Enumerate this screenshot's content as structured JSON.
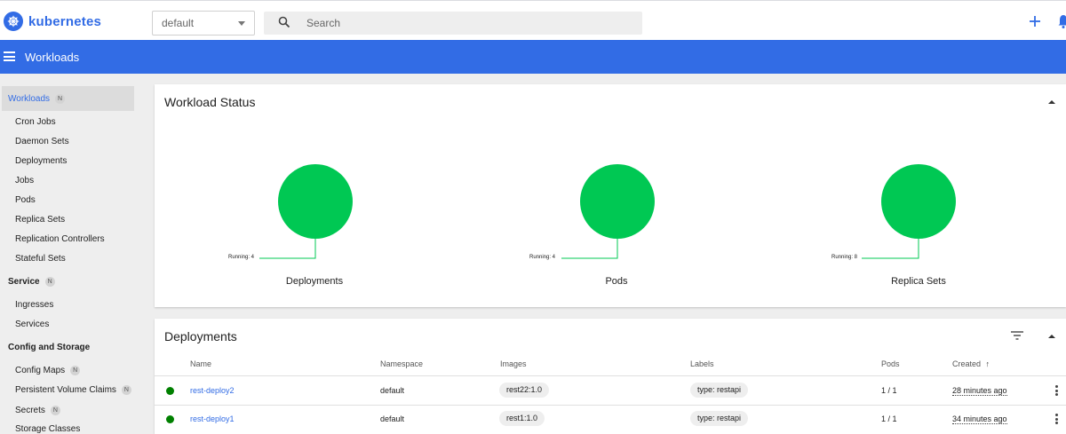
{
  "app": {
    "name": "kubernetes"
  },
  "header": {
    "namespace": "default",
    "search_placeholder": "Search"
  },
  "toolbar": {
    "title": "Workloads"
  },
  "sidebar": {
    "workloads": {
      "label": "Workloads",
      "badge": "N"
    },
    "workload_items": [
      "Cron Jobs",
      "Daemon Sets",
      "Deployments",
      "Jobs",
      "Pods",
      "Replica Sets",
      "Replication Controllers",
      "Stateful Sets"
    ],
    "service": {
      "label": "Service",
      "badge": "N"
    },
    "service_items": [
      "Ingresses",
      "Services"
    ],
    "config": {
      "label": "Config and Storage"
    },
    "config_items": [
      {
        "label": "Config Maps",
        "badge": "N"
      },
      {
        "label": "Persistent Volume Claims",
        "badge": "N"
      },
      {
        "label": "Secrets",
        "badge": "N"
      },
      {
        "label": "Storage Classes"
      }
    ]
  },
  "workload_status": {
    "title": "Workload Status",
    "charts": [
      {
        "label": "Deployments",
        "running_label": "Running: 4",
        "running": 4
      },
      {
        "label": "Pods",
        "running_label": "Running: 4",
        "running": 4
      },
      {
        "label": "Replica Sets",
        "running_label": "Running: 8",
        "running": 8
      }
    ],
    "colors": {
      "running": "#00c853",
      "line": "#00c853"
    }
  },
  "deployments": {
    "title": "Deployments",
    "columns": {
      "name": "Name",
      "namespace": "Namespace",
      "images": "Images",
      "labels": "Labels",
      "pods": "Pods",
      "created": "Created",
      "sort_indicator": "↑"
    },
    "rows": [
      {
        "name": "rest-deploy2",
        "namespace": "default",
        "image": "rest22:1.0",
        "label": "type: restapi",
        "pods": "1 / 1",
        "created": "28 minutes ago",
        "status": "running"
      },
      {
        "name": "rest-deploy1",
        "namespace": "default",
        "image": "rest1:1.0",
        "label": "type: restapi",
        "pods": "1 / 1",
        "created": "34 minutes ago",
        "status": "running"
      }
    ]
  },
  "colors": {
    "brand": "#326ce5",
    "status_ok": "#008000"
  }
}
